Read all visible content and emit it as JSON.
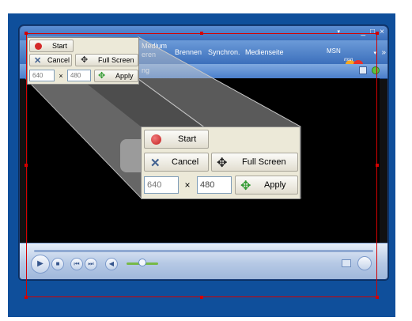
{
  "wmp": {
    "tabs": [
      "Medium",
      "Brennen",
      "Synchron.",
      "Medienseite"
    ],
    "tab_sub": "eren",
    "tab_sub2": "ng",
    "brand": "MSN",
    "brand_sub": "msn"
  },
  "panel": {
    "start_label": "Start",
    "cancel_label": "Cancel",
    "fullscreen_label": "Full Screen",
    "width_value": "640",
    "times_symbol": "×",
    "height_value": "480",
    "apply_label": "Apply"
  },
  "colors": {
    "background": "#0f4f9b",
    "selection": "#d40000",
    "panel_bg": "#ece9d8",
    "record": "#d42a2a"
  },
  "icons": {
    "start": "record-dot-icon",
    "cancel": "x-cross-icon",
    "fullscreen": "four-arrows-icon",
    "apply": "move-arrows-icon"
  }
}
